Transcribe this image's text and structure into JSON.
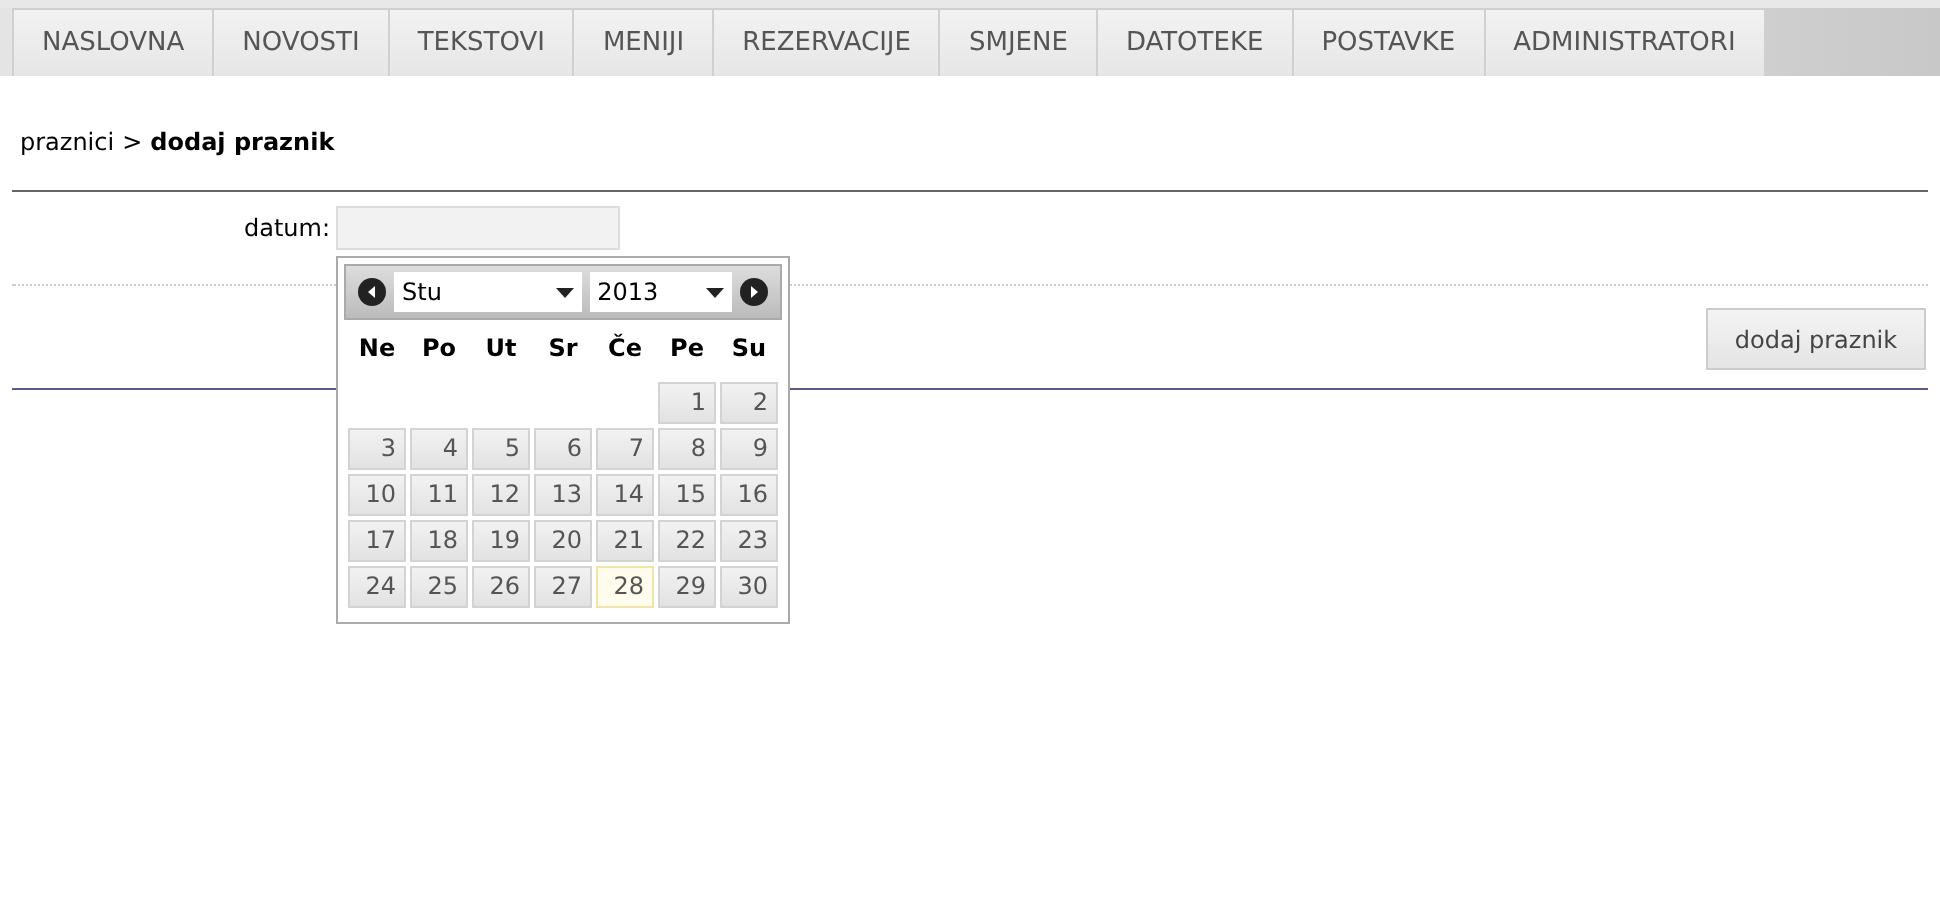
{
  "tabs": [
    {
      "label": "NASLOVNA",
      "selected": false
    },
    {
      "label": "NOVOSTI",
      "selected": false
    },
    {
      "label": "TEKSTOVI",
      "selected": false
    },
    {
      "label": "MENIJI",
      "selected": false
    },
    {
      "label": "REZERVACIJE",
      "selected": false
    },
    {
      "label": "SMJENE",
      "selected": false
    },
    {
      "label": "DATOTEKE",
      "selected": false
    },
    {
      "label": "POSTAVKE",
      "selected": false
    },
    {
      "label": "ADMINISTRATORI",
      "selected": false
    }
  ],
  "breadcrumb": {
    "parent": "praznici",
    "separator": ">",
    "current": "dodaj praznik"
  },
  "form": {
    "label": "datum:",
    "submit": "dodaj praznik"
  },
  "datepicker": {
    "month": "Stu",
    "year": "2013",
    "weekdays": [
      "Ne",
      "Po",
      "Ut",
      "Sr",
      "Če",
      "Pe",
      "Su"
    ],
    "weeks": [
      [
        {
          "label": "1",
          "today": false
        },
        {
          "label": "2",
          "today": false
        }
      ],
      [
        {
          "label": "3",
          "today": false
        },
        {
          "label": "4",
          "today": false
        },
        {
          "label": "5",
          "today": false
        },
        {
          "label": "6",
          "today": false
        },
        {
          "label": "7",
          "today": false
        },
        {
          "label": "8",
          "today": false
        },
        {
          "label": "9",
          "today": false
        }
      ],
      [
        {
          "label": "10",
          "today": false
        },
        {
          "label": "11",
          "today": false
        },
        {
          "label": "12",
          "today": false
        },
        {
          "label": "13",
          "today": false
        },
        {
          "label": "14",
          "today": false
        },
        {
          "label": "15",
          "today": false
        },
        {
          "label": "16",
          "today": false
        }
      ],
      [
        {
          "label": "17",
          "today": false
        },
        {
          "label": "18",
          "today": false
        },
        {
          "label": "19",
          "today": false
        },
        {
          "label": "20",
          "today": false
        },
        {
          "label": "21",
          "today": false
        },
        {
          "label": "22",
          "today": false
        },
        {
          "label": "23",
          "today": false
        }
      ],
      [
        {
          "label": "24",
          "today": false
        },
        {
          "label": "25",
          "today": false
        },
        {
          "label": "26",
          "today": false
        },
        {
          "label": "27",
          "today": false
        },
        {
          "label": "28",
          "today": true
        },
        {
          "label": "29",
          "today": false
        },
        {
          "label": "30",
          "today": false
        }
      ]
    ]
  }
}
